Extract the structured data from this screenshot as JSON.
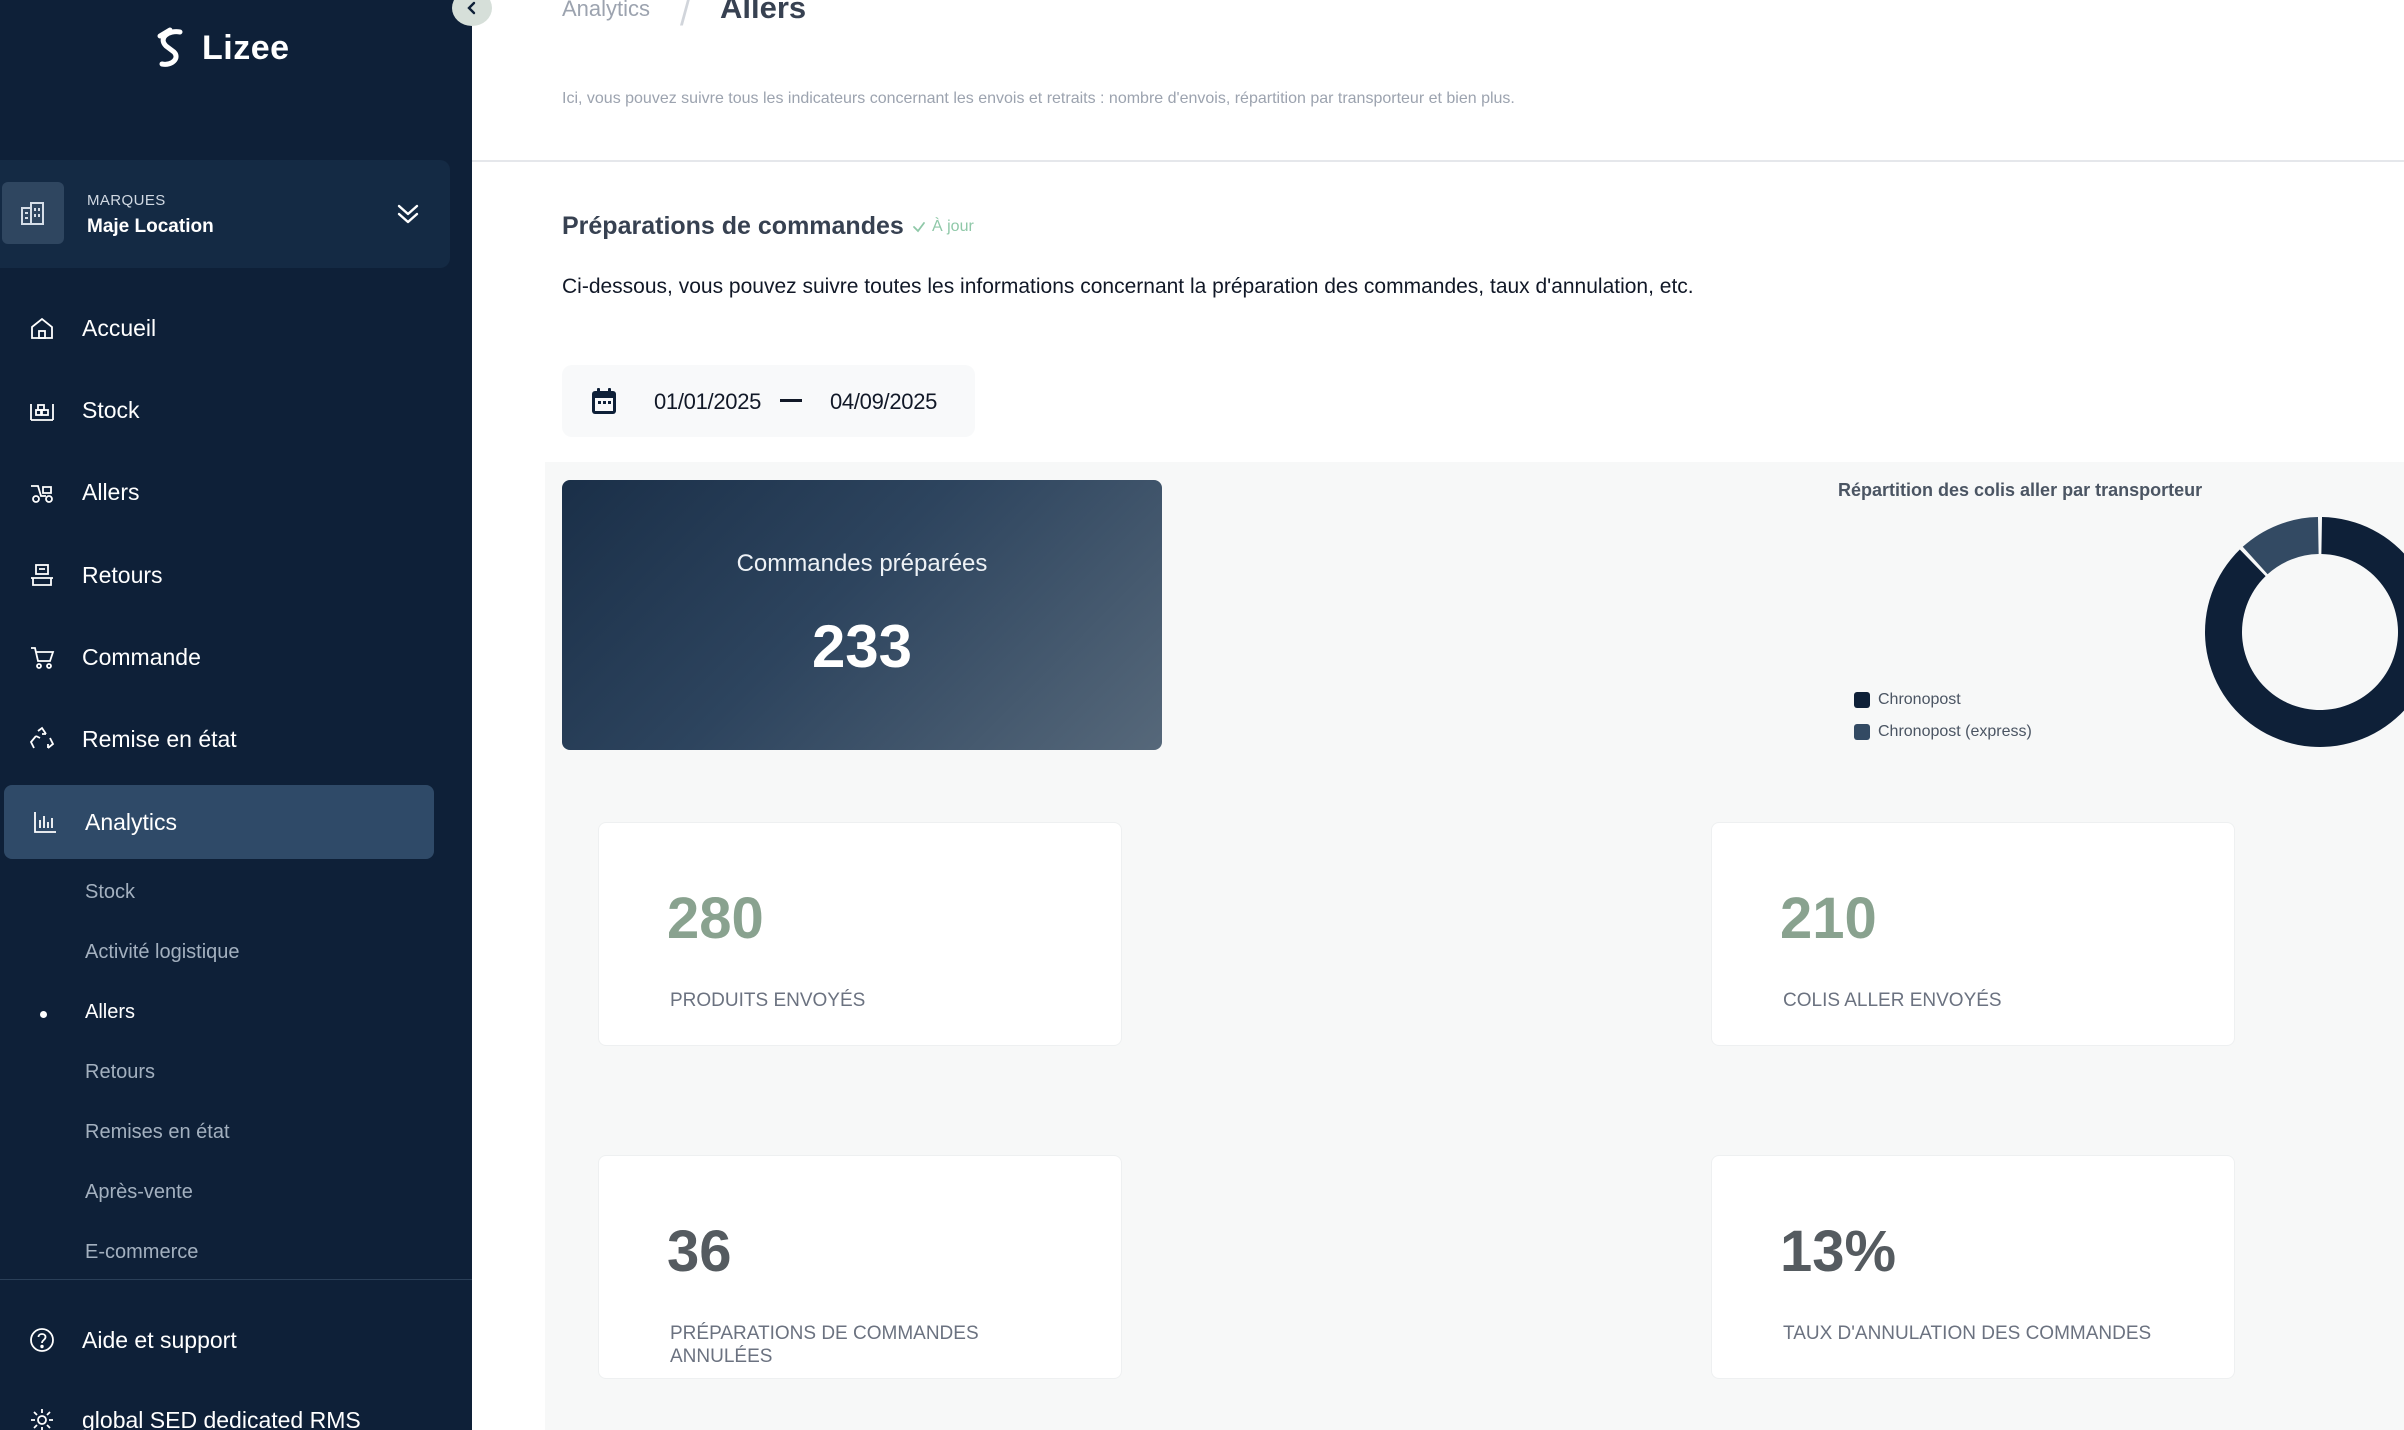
{
  "app": {
    "logo_text": "Lizee"
  },
  "brand_selector": {
    "caption": "MARQUES",
    "value": "Maje Location"
  },
  "sidebar": {
    "items": [
      {
        "label": "Accueil",
        "icon": "home-icon"
      },
      {
        "label": "Stock",
        "icon": "warehouse-icon"
      },
      {
        "label": "Allers",
        "icon": "delivery-icon"
      },
      {
        "label": "Retours",
        "icon": "return-icon"
      },
      {
        "label": "Commande",
        "icon": "cart-icon"
      },
      {
        "label": "Remise en état",
        "icon": "recycle-icon"
      },
      {
        "label": "Analytics",
        "icon": "bar-chart-icon",
        "active": true
      }
    ],
    "sub_items": [
      {
        "label": "Stock"
      },
      {
        "label": "Activité logistique"
      },
      {
        "label": "Allers",
        "current": true
      },
      {
        "label": "Retours"
      },
      {
        "label": "Remises en état"
      },
      {
        "label": "Après-vente"
      },
      {
        "label": "E-commerce"
      }
    ],
    "footer_items": [
      {
        "label": "Aide et support",
        "icon": "help-icon"
      },
      {
        "label": "global SED dedicated RMS",
        "icon": "gear-icon"
      }
    ]
  },
  "header": {
    "breadcrumb_parent": "Analytics",
    "title": "Allers",
    "description": "Ici, vous pouvez suivre tous les indicateurs concernant les envois et retraits : nombre d'envois, répartition par transporteur et bien plus."
  },
  "section": {
    "title": "Préparations de commandes",
    "status": "À jour",
    "description": "Ci-dessous, vous pouvez suivre toutes les informations concernant la préparation des commandes, taux d'annulation, etc."
  },
  "date_range": {
    "start": "01/01/2025",
    "end": "04/09/2025"
  },
  "hero": {
    "label": "Commandes préparées",
    "value": "233"
  },
  "kpis": {
    "produits": {
      "value": "280",
      "label": "PRODUITS ENVOYÉS"
    },
    "colis": {
      "value": "210",
      "label": "COLIS ALLER ENVOYÉS"
    },
    "annulees": {
      "value": "36",
      "label": "PRÉPARATIONS DE COMMANDES ANNULÉES"
    },
    "taux": {
      "value": "13%",
      "label": "TAUX D'ANNULATION DES COMMANDES"
    }
  },
  "colors": {
    "sidebar_bg": "#0e2038",
    "accent_green": "#89a28f",
    "chronopost": "#0e2038",
    "chronopost_express": "#334a63"
  },
  "chart_data": {
    "type": "pie",
    "title": "Répartition des colis aller par transporteur",
    "categories": [
      "Chronopost",
      "Chronopost (express)"
    ],
    "values": [
      88,
      12
    ],
    "colors": [
      "#0e2038",
      "#334a63"
    ],
    "donut": true,
    "legend_position": "left"
  }
}
